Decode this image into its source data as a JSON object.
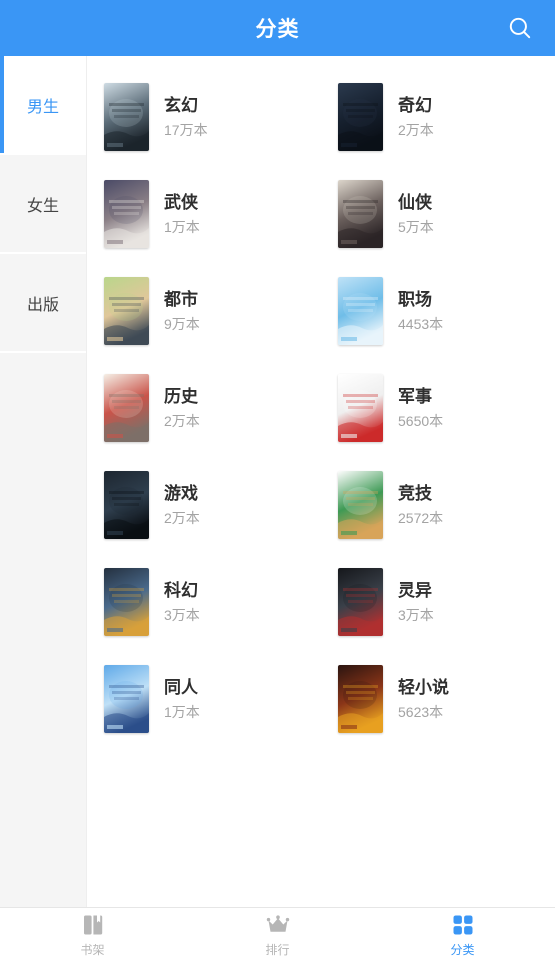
{
  "header": {
    "title": "分类",
    "search_icon": "search-icon",
    "bg_color": "#3a96f5"
  },
  "sidebar": {
    "items": [
      {
        "label": "男生",
        "active": true
      },
      {
        "label": "女生",
        "active": false
      },
      {
        "label": "出版",
        "active": false
      }
    ]
  },
  "categories": [
    {
      "name": "玄幻",
      "count": "17万本",
      "cover": "sheng-xu",
      "c1": "#cfdce4",
      "c2": "#5b6c78",
      "c3": "#1c242b"
    },
    {
      "name": "奇幻",
      "count": "2万本",
      "cover": "long-zu",
      "c1": "#2b3a4e",
      "c2": "#16202e",
      "c3": "#0b1018"
    },
    {
      "name": "武侠",
      "count": "1万本",
      "cover": "wu-xia",
      "c1": "#4a4a66",
      "c2": "#8a7f86",
      "c3": "#e8e4e0"
    },
    {
      "name": "仙侠",
      "count": "5万本",
      "cover": "jian-lai",
      "c1": "#ddd6cc",
      "c2": "#6a5f5c",
      "c3": "#2b2426"
    },
    {
      "name": "都市",
      "count": "9万本",
      "cover": "du-shi",
      "c1": "#b9d68b",
      "c2": "#e0c79a",
      "c3": "#3f4a56"
    },
    {
      "name": "职场",
      "count": "4453本",
      "cover": "zhi-chang",
      "c1": "#bfe2f7",
      "c2": "#6fbde8",
      "c3": "#e8f4fb"
    },
    {
      "name": "历史",
      "count": "2万本",
      "cover": "li-shi",
      "c1": "#f5efe6",
      "c2": "#c9544a",
      "c3": "#7d7068"
    },
    {
      "name": "军事",
      "count": "5650本",
      "cover": "jun-shi",
      "c1": "#ffffff",
      "c2": "#efefef",
      "c3": "#cc2a2a"
    },
    {
      "name": "游戏",
      "count": "2万本",
      "cover": "you-xi",
      "c1": "#1d2630",
      "c2": "#2f3f4e",
      "c3": "#0a0e13"
    },
    {
      "name": "竞技",
      "count": "2572本",
      "cover": "jing-ji",
      "c1": "#fdfdfd",
      "c2": "#3e9a55",
      "c3": "#d8a45a"
    },
    {
      "name": "科幻",
      "count": "3万本",
      "cover": "ke-huan",
      "c1": "#24303f",
      "c2": "#4a6a8c",
      "c3": "#d8a13a"
    },
    {
      "name": "灵异",
      "count": "3万本",
      "cover": "ling-yi",
      "c1": "#15171b",
      "c2": "#3a4049",
      "c3": "#b03030"
    },
    {
      "name": "同人",
      "count": "1万本",
      "cover": "tong-ren",
      "c1": "#5fa9e8",
      "c2": "#bfe0f7",
      "c3": "#2c4f8a"
    },
    {
      "name": "轻小说",
      "count": "5623本",
      "cover": "qing-xiaoshuo",
      "c1": "#2a1410",
      "c2": "#8a3518",
      "c3": "#e8a020"
    }
  ],
  "bottom_nav": {
    "items": [
      {
        "label": "书架",
        "icon": "book-icon",
        "active": false
      },
      {
        "label": "排行",
        "icon": "crown-icon",
        "active": false
      },
      {
        "label": "分类",
        "icon": "grid-icon",
        "active": true
      }
    ],
    "active_color": "#3a96f5",
    "inactive_color": "#b6b6b6"
  }
}
